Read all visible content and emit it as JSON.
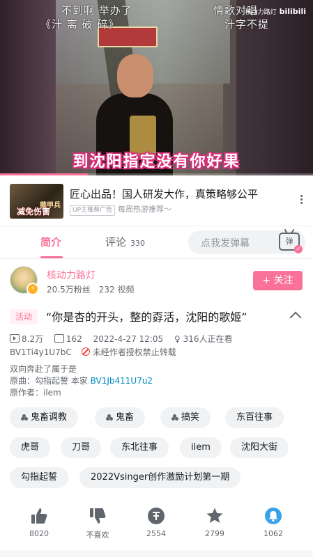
{
  "video": {
    "overlay_left": "不到啊 举办了",
    "overlay_left2": "《汁 离 破 碎》",
    "overlay_right": "情歌对唱",
    "overlay_right2": "汁字不提",
    "subtitle": "到沈阳指定没有你好果",
    "watermark_user": "核动力路灯",
    "watermark_brand": "bilibili",
    "progress_percent": 28
  },
  "ad": {
    "thumb_text": "藤甲兵",
    "thumb_text2": "减免伤害",
    "title": "匠心出品！国人研发大作，真策略够公平",
    "badge": "UP主推荐广告",
    "subtitle": "每周热游推荐～"
  },
  "tabs": {
    "intro": "简介",
    "comments": "评论",
    "comment_count": "330",
    "danmaku_placeholder": "点我发弹幕",
    "danmaku_icon": "弹"
  },
  "author": {
    "name": "核动力路灯",
    "fans": "20.5万粉丝",
    "videos": "232 视频",
    "follow_label": "+ 关注"
  },
  "video_info": {
    "activity_tag": "活动",
    "title": "“你是杏的开头，整的孬活，沈阳的歌姬”",
    "plays": "8.2万",
    "danmaku": "162",
    "date": "2022-4-27 12:05",
    "watching": "316人正在看",
    "bvid": "BV1Ti4y1U7bC",
    "no_repost": "未经作者授权禁止转载",
    "desc_line1": "双向奔赴了属于是",
    "desc_line2_prefix": "原曲：勾指起誓 本家 ",
    "desc_link": "BV1Jb411U7u2",
    "desc_line3": "原作者：ilem"
  },
  "tags": [
    "鬼畜调教",
    "鬼畜",
    "搞笑",
    "东百往事",
    "虎哥",
    "刀哥",
    "东北往事",
    "ilem",
    "沈阳大街",
    "勾指起誓",
    "2022Vsinger创作激励计划第一期"
  ],
  "actions": {
    "like": "8020",
    "dislike": "不喜欢",
    "coin": "2554",
    "favorite": "2799",
    "share": "1062"
  },
  "colors": {
    "accent": "#fb7299",
    "link": "#008ac5"
  }
}
